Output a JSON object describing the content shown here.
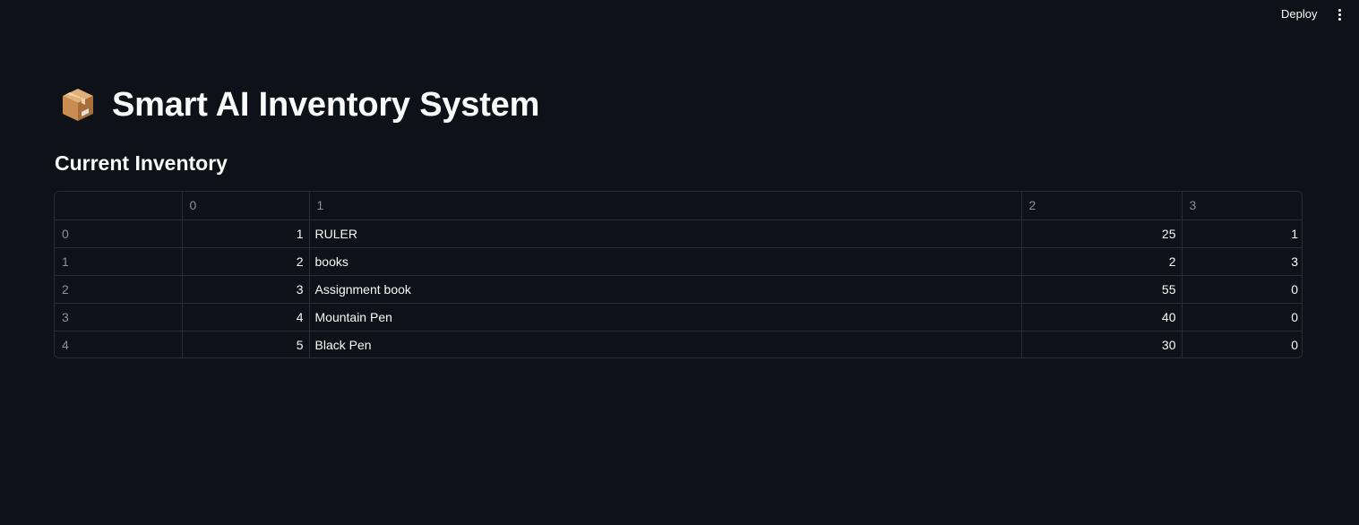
{
  "header": {
    "deploy_label": "Deploy",
    "menu_icon": "vertical-ellipsis-icon"
  },
  "main": {
    "title_icon": "package-box-icon",
    "title": "Smart AI Inventory System",
    "subheader": "Current Inventory"
  },
  "table": {
    "columns": [
      "",
      "0",
      "1",
      "2",
      "3"
    ],
    "rows": [
      {
        "index": "0",
        "c0": "1",
        "c1": "RULER",
        "c2": "25",
        "c3": "1"
      },
      {
        "index": "1",
        "c0": "2",
        "c1": "books",
        "c2": "2",
        "c3": "3"
      },
      {
        "index": "2",
        "c0": "3",
        "c1": "Assignment book",
        "c2": "55",
        "c3": "0"
      },
      {
        "index": "3",
        "c0": "4",
        "c1": "Mountain Pen",
        "c2": "40",
        "c3": "0"
      },
      {
        "index": "4",
        "c0": "5",
        "c1": "Black Pen",
        "c2": "30",
        "c3": "0"
      }
    ]
  },
  "colors": {
    "background": "#0e1117",
    "text": "#fafafa",
    "muted_text": "#8b8f98",
    "border": "#2a2d35"
  }
}
